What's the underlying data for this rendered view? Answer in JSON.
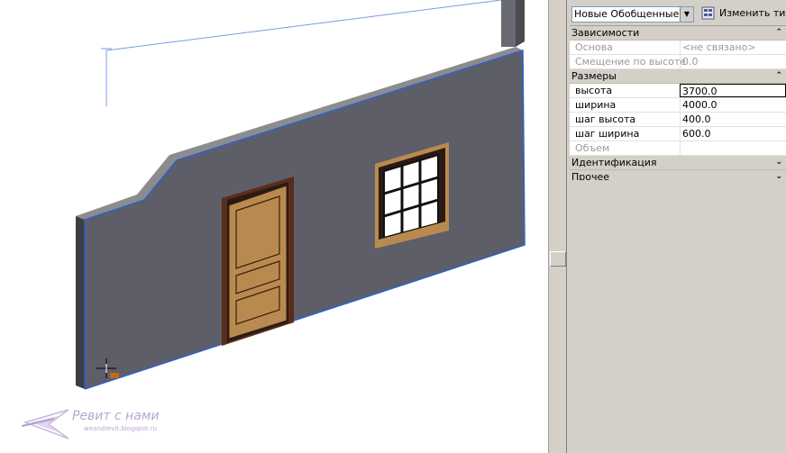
{
  "properties": {
    "type_selector": {
      "value": "Новые Обобщенные м"
    },
    "edit_type_label": "Изменить тип",
    "groups": [
      {
        "title": "Зависимости",
        "chevron": "⌃",
        "rows": [
          {
            "label": "Основа",
            "value": "<не связано>",
            "disabled": true
          },
          {
            "label": "Смещение по высоте",
            "value": "0.0",
            "disabled": true
          }
        ]
      },
      {
        "title": "Размеры",
        "chevron": "⌃",
        "rows": [
          {
            "label": "высота",
            "value": "3700.0",
            "disabled": false,
            "editing": true
          },
          {
            "label": "ширина",
            "value": "4000.0",
            "disabled": false
          },
          {
            "label": "шаг высота",
            "value": "400.0",
            "disabled": false
          },
          {
            "label": "шаг ширина",
            "value": "600.0",
            "disabled": false
          },
          {
            "label": "Объем",
            "value": "",
            "disabled": true
          }
        ]
      },
      {
        "title": "Идентификация",
        "chevron": "⌄",
        "rows": []
      },
      {
        "title": "Прочее",
        "chevron": "⌄",
        "rows": []
      }
    ]
  },
  "watermark": {
    "brand": "Ревит с нами",
    "site": "weandrevit.blogspot.ru"
  },
  "colors": {
    "wall_face": "#5e5e68",
    "wall_top": "#8c8c8c",
    "wall_side": "#3d3d44",
    "edge_highlight": "#2f5fd0",
    "door": "#b98a50",
    "frame": "#5a2c1c",
    "panel_bg": "#d4d0c8"
  },
  "icons": {
    "edit_type": "edit-type-icon",
    "cursor": "move-cursor-icon",
    "dropdown": "dropdown-arrow-icon"
  }
}
